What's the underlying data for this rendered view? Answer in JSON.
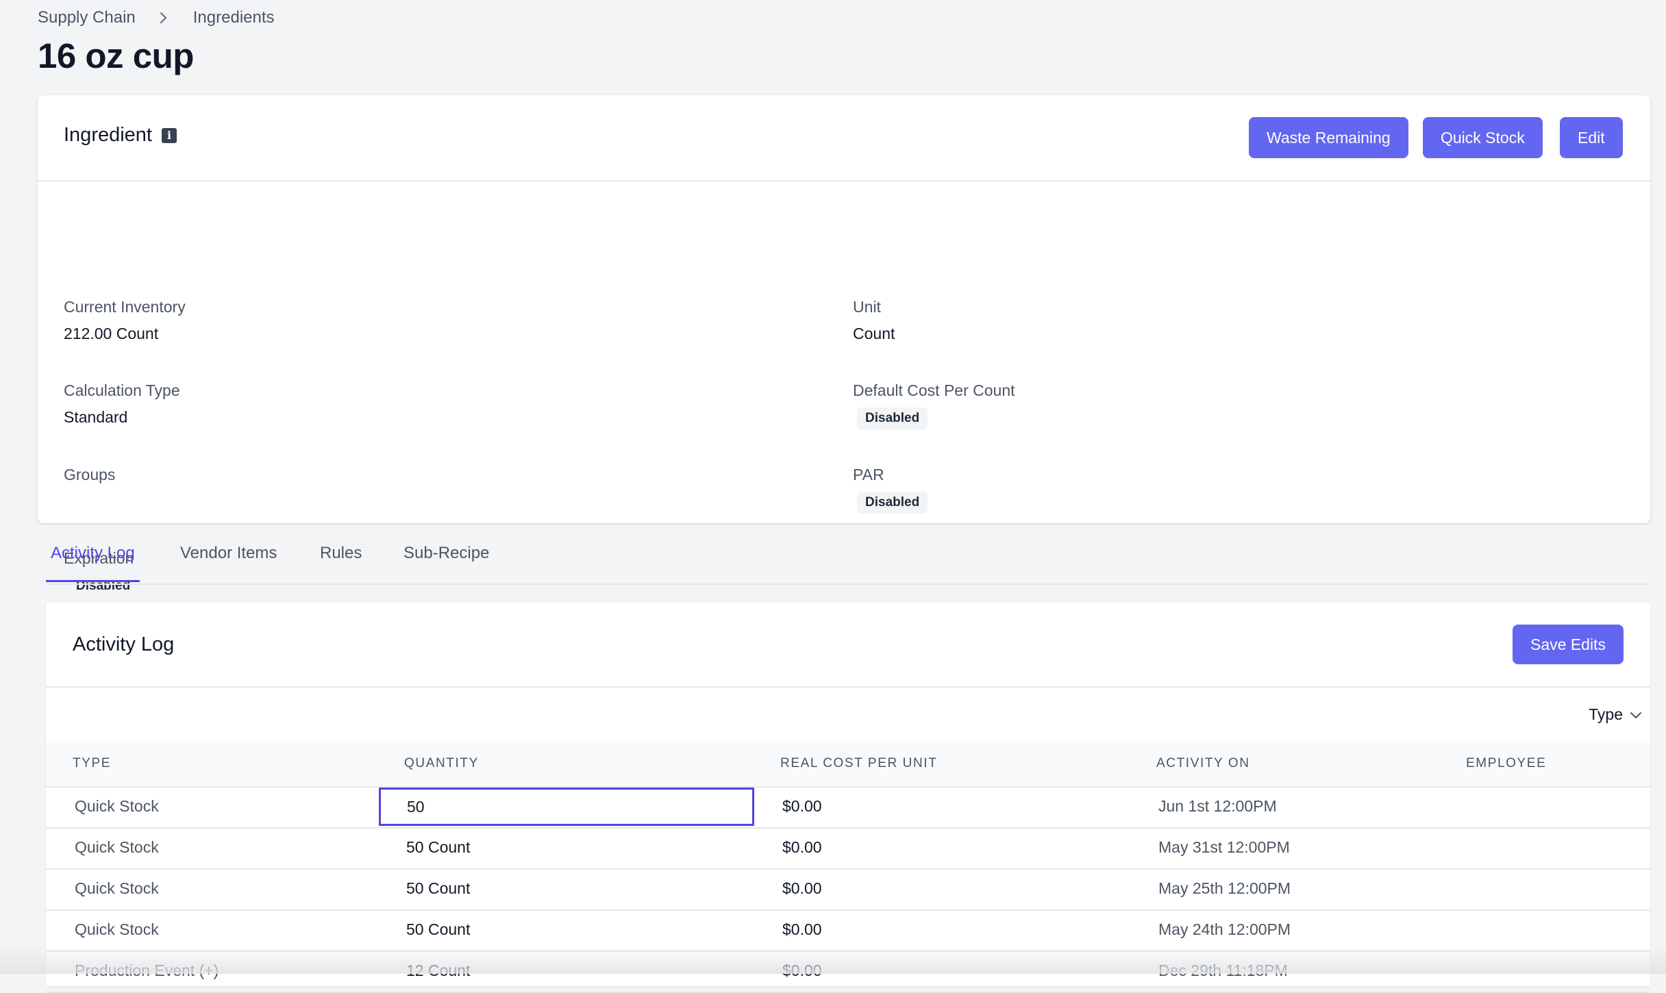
{
  "breadcrumb": {
    "parent": "Supply Chain",
    "current": "Ingredients"
  },
  "page_title": "16 oz cup",
  "ingredient_card": {
    "title": "Ingredient",
    "buttons": {
      "waste": "Waste Remaining",
      "quick_stock": "Quick Stock",
      "edit": "Edit"
    },
    "fields": {
      "current_inventory": {
        "label": "Current Inventory",
        "value": "212.00 Count"
      },
      "unit": {
        "label": "Unit",
        "value": "Count"
      },
      "calculation_type": {
        "label": "Calculation Type",
        "value": "Standard"
      },
      "default_cost": {
        "label": "Default Cost Per Count",
        "badge": "Disabled"
      },
      "groups": {
        "label": "Groups",
        "value": ""
      },
      "par": {
        "label": "PAR",
        "badge": "Disabled"
      },
      "expiration": {
        "label": "Expiration",
        "badge": "Disabled"
      }
    }
  },
  "tabs": [
    "Activity Log",
    "Vendor Items",
    "Rules",
    "Sub-Recipe"
  ],
  "activity_log": {
    "title": "Activity Log",
    "save_label": "Save Edits",
    "filter_label": "Type",
    "columns": [
      "TYPE",
      "QUANTITY",
      "REAL COST PER UNIT",
      "ACTIVITY ON",
      "EMPLOYEE"
    ],
    "rows": [
      {
        "type": "Quick Stock",
        "quantity": "50",
        "cost": "$0.00",
        "activity_on": "Jun 1st 12:00PM",
        "employee": ""
      },
      {
        "type": "Quick Stock",
        "quantity": "50 Count",
        "cost": "$0.00",
        "activity_on": "May 31st 12:00PM",
        "employee": ""
      },
      {
        "type": "Quick Stock",
        "quantity": "50 Count",
        "cost": "$0.00",
        "activity_on": "May 25th 12:00PM",
        "employee": ""
      },
      {
        "type": "Quick Stock",
        "quantity": "50 Count",
        "cost": "$0.00",
        "activity_on": "May 24th 12:00PM",
        "employee": ""
      },
      {
        "type": "Production Event (+)",
        "quantity": "12 Count",
        "cost": "$0.00",
        "activity_on": "Dec 29th 11:18PM",
        "employee": ""
      }
    ]
  },
  "colors": {
    "accent": "#6366f1",
    "accent_text": "#4f46e5",
    "background": "#f3f4f6"
  }
}
